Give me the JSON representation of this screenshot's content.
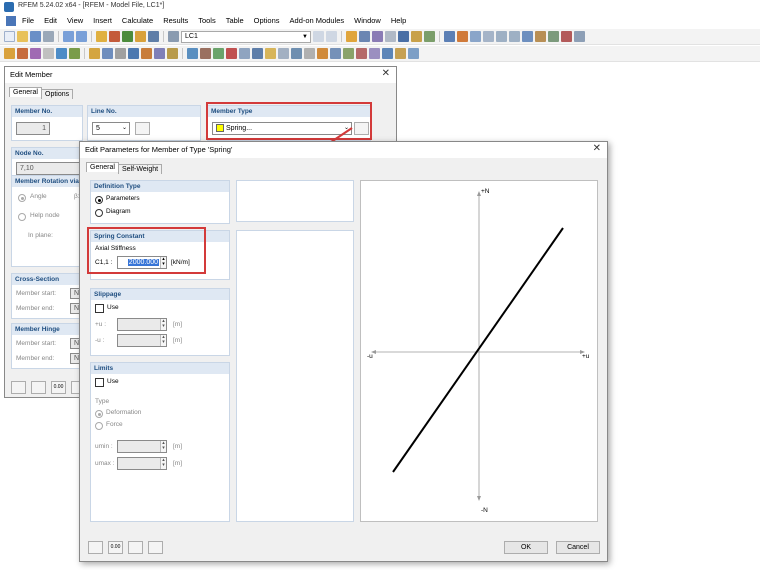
{
  "app": {
    "title": "RFEM 5.24.02 x64 - [RFEM - Model File, LC1*]",
    "menu": [
      "File",
      "Edit",
      "View",
      "Insert",
      "Calculate",
      "Results",
      "Tools",
      "Table",
      "Options",
      "Add-on Modules",
      "Window",
      "Help"
    ],
    "load_case": "LC1"
  },
  "edit_member": {
    "title": "Edit Member",
    "tabs": [
      "General",
      "Options"
    ],
    "member_no_label": "Member No.",
    "member_no": "1",
    "line_no_label": "Line No.",
    "line_no": "5",
    "member_type_label": "Member Type",
    "member_type": "Spring...",
    "node_no_label": "Node No.",
    "node_no": "7,10",
    "rotation_label": "Member Rotation via",
    "angle_label": "Angle",
    "angle_symbol": "β:",
    "help_node_label": "Help node",
    "in_plane_label": "In plane:",
    "cross_section_label": "Cross-Section",
    "cs_start_label": "Member start:",
    "cs_start_value": "Non",
    "cs_end_label": "Member end:",
    "cs_end_value": "Non",
    "hinge_label": "Member Hinge",
    "hinge_start_label": "Member start:",
    "hinge_start_value": "Non",
    "hinge_end_label": "Member end:",
    "hinge_end_value": "Non",
    "zero_button": "0.00"
  },
  "spring_dialog": {
    "title": "Edit Parameters for Member of Type 'Spring'",
    "tabs": [
      "General",
      "Self-Weight"
    ],
    "definition_type_label": "Definition Type",
    "parameters_label": "Parameters",
    "diagram_label": "Diagram",
    "spring_constant_label": "Spring Constant",
    "axial_stiffness_label": "Axial Stiffness",
    "c11_label": "C1,1 :",
    "c11_value": "2000.000",
    "c11_unit": "[kN/m]",
    "slippage_label": "Slippage",
    "slip_use_label": "Use",
    "plus_u_label": "+u :",
    "minus_u_label": "-u :",
    "unit_m": "[m]",
    "limits_label": "Limits",
    "limits_use_label": "Use",
    "type_label": "Type",
    "deformation_label": "Deformation",
    "force_label": "Force",
    "umin_label": "umin :",
    "umax_label": "umax :",
    "ok_label": "OK",
    "cancel_label": "Cancel",
    "zero_button": "0.00",
    "graph": {
      "plus_n": "+N",
      "minus_n": "-N",
      "minus_u": "-u",
      "plus_u": "+u"
    }
  },
  "colors": {
    "highlight_red": "#d33a3a",
    "panel_header": "#dfe8f3",
    "member_type_swatch": "#ffff00",
    "selection_blue": "#3875d7"
  }
}
